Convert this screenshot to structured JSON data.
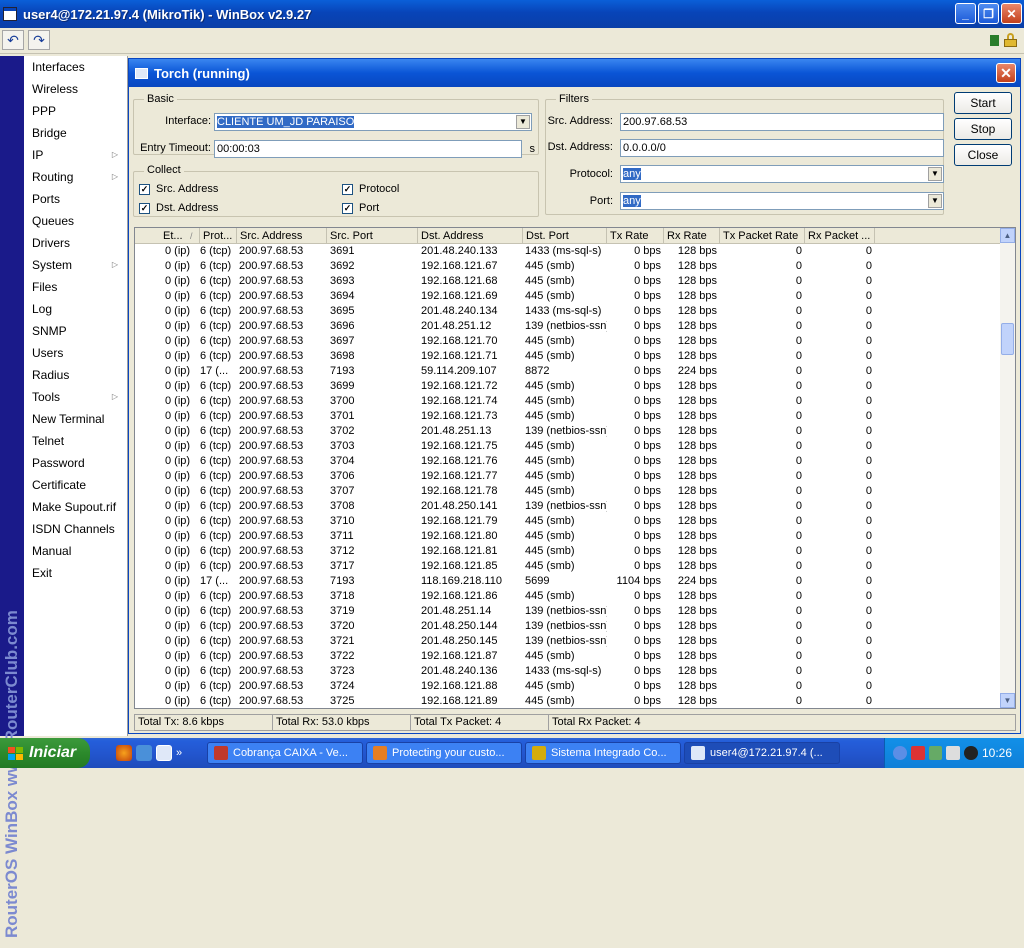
{
  "window": {
    "title": "user4@172.21.97.4 (MikroTik) - WinBox v2.9.27",
    "minimize": "_",
    "restore": "❐",
    "close": "✕"
  },
  "toolbar": {
    "undo_icon": "↶",
    "redo_icon": "↷"
  },
  "brand": "RouterOS WinBox   www.RouterClub.com",
  "menu": [
    {
      "label": "Interfaces",
      "arrow": ""
    },
    {
      "label": "Wireless",
      "arrow": ""
    },
    {
      "label": "PPP",
      "arrow": ""
    },
    {
      "label": "Bridge",
      "arrow": ""
    },
    {
      "label": "IP",
      "arrow": "▷"
    },
    {
      "label": "Routing",
      "arrow": "▷"
    },
    {
      "label": "Ports",
      "arrow": ""
    },
    {
      "label": "Queues",
      "arrow": ""
    },
    {
      "label": "Drivers",
      "arrow": ""
    },
    {
      "label": "System",
      "arrow": "▷"
    },
    {
      "label": "Files",
      "arrow": ""
    },
    {
      "label": "Log",
      "arrow": ""
    },
    {
      "label": "SNMP",
      "arrow": ""
    },
    {
      "label": "Users",
      "arrow": ""
    },
    {
      "label": "Radius",
      "arrow": ""
    },
    {
      "label": "Tools",
      "arrow": "▷"
    },
    {
      "label": "New Terminal",
      "arrow": ""
    },
    {
      "label": "Telnet",
      "arrow": ""
    },
    {
      "label": "Password",
      "arrow": ""
    },
    {
      "label": "Certificate",
      "arrow": ""
    },
    {
      "label": "Make Supout.rif",
      "arrow": ""
    },
    {
      "label": "ISDN Channels",
      "arrow": ""
    },
    {
      "label": "Manual",
      "arrow": ""
    },
    {
      "label": "Exit",
      "arrow": ""
    }
  ],
  "torch": {
    "title": "Torch (running)",
    "close": "✕",
    "basic": {
      "group_label": "Basic",
      "interface_label": "Interface:",
      "interface_value": "CLIENTE UM_JD PARAISO",
      "timeout_label": "Entry Timeout:",
      "timeout_value": "00:00:03",
      "timeout_unit": "s"
    },
    "collect": {
      "group_label": "Collect",
      "src_address": "Src. Address",
      "dst_address": "Dst. Address",
      "protocol": "Protocol",
      "port": "Port",
      "check": "✓"
    },
    "filters": {
      "group_label": "Filters",
      "src_label": "Src. Address:",
      "src_value": "200.97.68.53",
      "dst_label": "Dst. Address:",
      "dst_value": "0.0.0.0/0",
      "protocol_label": "Protocol:",
      "protocol_value": "any",
      "port_label": "Port:",
      "port_value": "any"
    },
    "buttons": {
      "start": "Start",
      "stop": "Stop",
      "close": "Close"
    },
    "columns": [
      "Et...",
      "Prot...",
      "Src. Address",
      "Src. Port",
      "Dst. Address",
      "Dst. Port",
      "Tx Rate",
      "Rx Rate",
      "Tx Packet Rate",
      "Rx Packet ..."
    ],
    "sort_mark": "/",
    "rows": [
      [
        "0 (ip)",
        "6 (tcp)",
        "200.97.68.53",
        "3691",
        "201.48.240.133",
        "1433 (ms-sql-s)",
        "0 bps",
        "128 bps",
        "0",
        "0"
      ],
      [
        "0 (ip)",
        "6 (tcp)",
        "200.97.68.53",
        "3692",
        "192.168.121.67",
        "445 (smb)",
        "0 bps",
        "128 bps",
        "0",
        "0"
      ],
      [
        "0 (ip)",
        "6 (tcp)",
        "200.97.68.53",
        "3693",
        "192.168.121.68",
        "445 (smb)",
        "0 bps",
        "128 bps",
        "0",
        "0"
      ],
      [
        "0 (ip)",
        "6 (tcp)",
        "200.97.68.53",
        "3694",
        "192.168.121.69",
        "445 (smb)",
        "0 bps",
        "128 bps",
        "0",
        "0"
      ],
      [
        "0 (ip)",
        "6 (tcp)",
        "200.97.68.53",
        "3695",
        "201.48.240.134",
        "1433 (ms-sql-s)",
        "0 bps",
        "128 bps",
        "0",
        "0"
      ],
      [
        "0 (ip)",
        "6 (tcp)",
        "200.97.68.53",
        "3696",
        "201.48.251.12",
        "139 (netbios-ssn)",
        "0 bps",
        "128 bps",
        "0",
        "0"
      ],
      [
        "0 (ip)",
        "6 (tcp)",
        "200.97.68.53",
        "3697",
        "192.168.121.70",
        "445 (smb)",
        "0 bps",
        "128 bps",
        "0",
        "0"
      ],
      [
        "0 (ip)",
        "6 (tcp)",
        "200.97.68.53",
        "3698",
        "192.168.121.71",
        "445 (smb)",
        "0 bps",
        "128 bps",
        "0",
        "0"
      ],
      [
        "0 (ip)",
        "17 (...",
        "200.97.68.53",
        "7193",
        "59.114.209.107",
        "8872",
        "0 bps",
        "224 bps",
        "0",
        "0"
      ],
      [
        "0 (ip)",
        "6 (tcp)",
        "200.97.68.53",
        "3699",
        "192.168.121.72",
        "445 (smb)",
        "0 bps",
        "128 bps",
        "0",
        "0"
      ],
      [
        "0 (ip)",
        "6 (tcp)",
        "200.97.68.53",
        "3700",
        "192.168.121.74",
        "445 (smb)",
        "0 bps",
        "128 bps",
        "0",
        "0"
      ],
      [
        "0 (ip)",
        "6 (tcp)",
        "200.97.68.53",
        "3701",
        "192.168.121.73",
        "445 (smb)",
        "0 bps",
        "128 bps",
        "0",
        "0"
      ],
      [
        "0 (ip)",
        "6 (tcp)",
        "200.97.68.53",
        "3702",
        "201.48.251.13",
        "139 (netbios-ssn)",
        "0 bps",
        "128 bps",
        "0",
        "0"
      ],
      [
        "0 (ip)",
        "6 (tcp)",
        "200.97.68.53",
        "3703",
        "192.168.121.75",
        "445 (smb)",
        "0 bps",
        "128 bps",
        "0",
        "0"
      ],
      [
        "0 (ip)",
        "6 (tcp)",
        "200.97.68.53",
        "3704",
        "192.168.121.76",
        "445 (smb)",
        "0 bps",
        "128 bps",
        "0",
        "0"
      ],
      [
        "0 (ip)",
        "6 (tcp)",
        "200.97.68.53",
        "3706",
        "192.168.121.77",
        "445 (smb)",
        "0 bps",
        "128 bps",
        "0",
        "0"
      ],
      [
        "0 (ip)",
        "6 (tcp)",
        "200.97.68.53",
        "3707",
        "192.168.121.78",
        "445 (smb)",
        "0 bps",
        "128 bps",
        "0",
        "0"
      ],
      [
        "0 (ip)",
        "6 (tcp)",
        "200.97.68.53",
        "3708",
        "201.48.250.141",
        "139 (netbios-ssn)",
        "0 bps",
        "128 bps",
        "0",
        "0"
      ],
      [
        "0 (ip)",
        "6 (tcp)",
        "200.97.68.53",
        "3710",
        "192.168.121.79",
        "445 (smb)",
        "0 bps",
        "128 bps",
        "0",
        "0"
      ],
      [
        "0 (ip)",
        "6 (tcp)",
        "200.97.68.53",
        "3711",
        "192.168.121.80",
        "445 (smb)",
        "0 bps",
        "128 bps",
        "0",
        "0"
      ],
      [
        "0 (ip)",
        "6 (tcp)",
        "200.97.68.53",
        "3712",
        "192.168.121.81",
        "445 (smb)",
        "0 bps",
        "128 bps",
        "0",
        "0"
      ],
      [
        "0 (ip)",
        "6 (tcp)",
        "200.97.68.53",
        "3717",
        "192.168.121.85",
        "445 (smb)",
        "0 bps",
        "128 bps",
        "0",
        "0"
      ],
      [
        "0 (ip)",
        "17 (...",
        "200.97.68.53",
        "7193",
        "118.169.218.110",
        "5699",
        "1104 bps",
        "224 bps",
        "0",
        "0"
      ],
      [
        "0 (ip)",
        "6 (tcp)",
        "200.97.68.53",
        "3718",
        "192.168.121.86",
        "445 (smb)",
        "0 bps",
        "128 bps",
        "0",
        "0"
      ],
      [
        "0 (ip)",
        "6 (tcp)",
        "200.97.68.53",
        "3719",
        "201.48.251.14",
        "139 (netbios-ssn)",
        "0 bps",
        "128 bps",
        "0",
        "0"
      ],
      [
        "0 (ip)",
        "6 (tcp)",
        "200.97.68.53",
        "3720",
        "201.48.250.144",
        "139 (netbios-ssn)",
        "0 bps",
        "128 bps",
        "0",
        "0"
      ],
      [
        "0 (ip)",
        "6 (tcp)",
        "200.97.68.53",
        "3721",
        "201.48.250.145",
        "139 (netbios-ssn)",
        "0 bps",
        "128 bps",
        "0",
        "0"
      ],
      [
        "0 (ip)",
        "6 (tcp)",
        "200.97.68.53",
        "3722",
        "192.168.121.87",
        "445 (smb)",
        "0 bps",
        "128 bps",
        "0",
        "0"
      ],
      [
        "0 (ip)",
        "6 (tcp)",
        "200.97.68.53",
        "3723",
        "201.48.240.136",
        "1433 (ms-sql-s)",
        "0 bps",
        "128 bps",
        "0",
        "0"
      ],
      [
        "0 (ip)",
        "6 (tcp)",
        "200.97.68.53",
        "3724",
        "192.168.121.88",
        "445 (smb)",
        "0 bps",
        "128 bps",
        "0",
        "0"
      ],
      [
        "0 (ip)",
        "6 (tcp)",
        "200.97.68.53",
        "3725",
        "192.168.121.89",
        "445 (smb)",
        "0 bps",
        "128 bps",
        "0",
        "0"
      ]
    ],
    "scroll": {
      "up": "▲",
      "down": "▼"
    },
    "status": {
      "total_tx": "Total Tx: 8.6 kbps",
      "total_rx": "Total Rx: 53.0 kbps",
      "total_tx_packet": "Total Tx Packet: 4",
      "total_rx_packet": "Total Rx Packet: 4"
    }
  },
  "taskbar": {
    "start": "Iniciar",
    "quicklaunch_more": "»",
    "tasks": [
      {
        "label": "Cobrança CAIXA - Ve...",
        "icon_color": "#c0392b"
      },
      {
        "label": "Protecting your custo...",
        "icon_color": "#e67e22"
      },
      {
        "label": "Sistema Integrado Co...",
        "icon_color": "#d4ac0d"
      },
      {
        "label": "user4@172.21.97.4 (...",
        "icon_color": "#dfe8f8"
      }
    ],
    "clock": "10:26"
  },
  "colors": {
    "xp_blue": "#0a55d6",
    "selection": "#316ac5",
    "brand_bar": "#1a1a8a"
  }
}
